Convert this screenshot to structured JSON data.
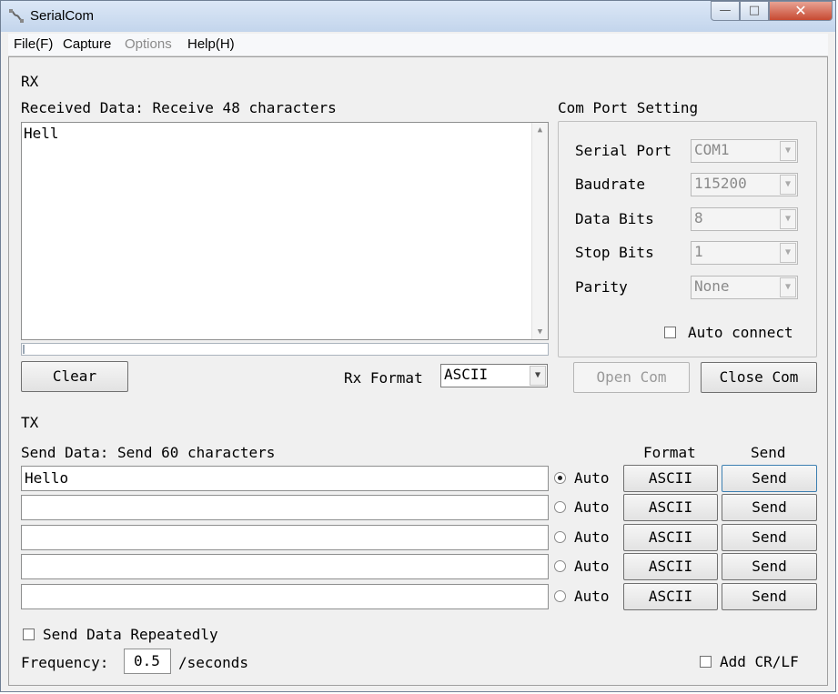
{
  "window": {
    "title": "SerialCom",
    "min": "—",
    "max": "□",
    "close": "✕"
  },
  "menu": [
    "File(F)",
    "Capture",
    "Options",
    "Help(H)"
  ],
  "rx": {
    "section": "RX",
    "received_label": "Received Data: Receive 48 characters",
    "received_text": "Hell",
    "clear_label": "Clear",
    "format_label": "Rx Format",
    "format_value": "ASCII"
  },
  "com": {
    "title": "Com Port Setting",
    "settings": [
      {
        "label": "Serial Port",
        "value": "COM1"
      },
      {
        "label": "Baudrate",
        "value": "115200"
      },
      {
        "label": "Data Bits",
        "value": "8"
      },
      {
        "label": "Stop Bits",
        "value": "1"
      },
      {
        "label": "Parity",
        "value": "None"
      }
    ],
    "auto_connect": "Auto connect",
    "open_label": "Open Com",
    "close_label": "Close Com"
  },
  "tx": {
    "section": "TX",
    "send_label": "Send Data: Send 60 characters",
    "format_header": "Format",
    "send_header": "Send",
    "rows": [
      {
        "text": "Hello",
        "auto": "Auto",
        "format": "ASCII",
        "send": "Send"
      },
      {
        "text": "",
        "auto": "Auto",
        "format": "ASCII",
        "send": "Send"
      },
      {
        "text": "",
        "auto": "Auto",
        "format": "ASCII",
        "send": "Send"
      },
      {
        "text": "",
        "auto": "Auto",
        "format": "ASCII",
        "send": "Send"
      },
      {
        "text": "",
        "auto": "Auto",
        "format": "ASCII",
        "send": "Send"
      }
    ],
    "repeat_label": "Send Data Repeatedly",
    "frequency_label": "Frequency:",
    "frequency_value": "0.5",
    "frequency_unit": "/seconds",
    "crlf_label": "Add CR/LF"
  }
}
